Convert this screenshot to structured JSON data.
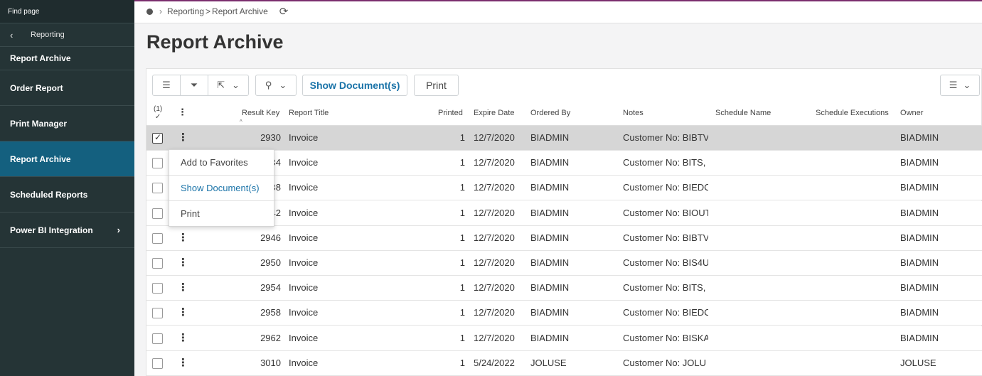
{
  "sidebar": {
    "find_page": "Find page",
    "back_label": "Reporting",
    "section_title": "Report Archive",
    "items": [
      {
        "label": "Order Report"
      },
      {
        "label": "Print Manager"
      },
      {
        "label": "Report Archive",
        "active": true
      },
      {
        "label": "Scheduled Reports"
      },
      {
        "label": "Power BI Integration",
        "has_children": true
      }
    ]
  },
  "breadcrumb": {
    "part1": "Reporting",
    "separator": ">",
    "part2": "Report Archive"
  },
  "page": {
    "title": "Report Archive"
  },
  "toolbar": {
    "show_documents": "Show Document(s)",
    "print": "Print"
  },
  "table": {
    "selected_count": "(1)",
    "columns": [
      "Result Key",
      "Report Title",
      "Printed",
      "Expire Date",
      "Ordered By",
      "Notes",
      "Schedule Name",
      "Schedule Executions",
      "Owner"
    ],
    "rows": [
      {
        "key": "2930",
        "title": "Invoice",
        "printed": "1",
        "expire": "12/7/2020",
        "ordered_by": "BIADMIN",
        "notes": "Customer No: BIBTV",
        "owner": "BIADMIN",
        "checked": true
      },
      {
        "key": "2934",
        "title": "Invoice",
        "printed": "1",
        "expire": "12/7/2020",
        "ordered_by": "BIADMIN",
        "notes": "Customer No: BITS,",
        "owner": "BIADMIN"
      },
      {
        "key": "2938",
        "title": "Invoice",
        "printed": "1",
        "expire": "12/7/2020",
        "ordered_by": "BIADMIN",
        "notes": "Customer No: BIEDC",
        "owner": "BIADMIN"
      },
      {
        "key": "2942",
        "title": "Invoice",
        "printed": "1",
        "expire": "12/7/2020",
        "ordered_by": "BIADMIN",
        "notes": "Customer No: BIOUT",
        "owner": "BIADMIN"
      },
      {
        "key": "2946",
        "title": "Invoice",
        "printed": "1",
        "expire": "12/7/2020",
        "ordered_by": "BIADMIN",
        "notes": "Customer No: BIBTV",
        "owner": "BIADMIN"
      },
      {
        "key": "2950",
        "title": "Invoice",
        "printed": "1",
        "expire": "12/7/2020",
        "ordered_by": "BIADMIN",
        "notes": "Customer No: BIS4U",
        "owner": "BIADMIN"
      },
      {
        "key": "2954",
        "title": "Invoice",
        "printed": "1",
        "expire": "12/7/2020",
        "ordered_by": "BIADMIN",
        "notes": "Customer No: BITS,",
        "owner": "BIADMIN"
      },
      {
        "key": "2958",
        "title": "Invoice",
        "printed": "1",
        "expire": "12/7/2020",
        "ordered_by": "BIADMIN",
        "notes": "Customer No: BIEDC",
        "owner": "BIADMIN"
      },
      {
        "key": "2962",
        "title": "Invoice",
        "printed": "1",
        "expire": "12/7/2020",
        "ordered_by": "BIADMIN",
        "notes": "Customer No: BISKA",
        "owner": "BIADMIN"
      },
      {
        "key": "3010",
        "title": "Invoice",
        "printed": "1",
        "expire": "5/24/2022",
        "ordered_by": "JOLUSE",
        "notes": "Customer No: JOLU",
        "owner": "JOLUSE"
      }
    ]
  },
  "context_menu": {
    "items": [
      "Add to Favorites",
      "Show Document(s)",
      "Print"
    ]
  },
  "colors": {
    "sidebar_bg": "#253436",
    "sidebar_active": "#14607f",
    "accent_link": "#1a73a8"
  },
  "icons": [
    "chevron-left-icon",
    "chevron-right-icon",
    "home-dot-icon",
    "refresh-icon",
    "list-icon",
    "filter-icon",
    "export-icon",
    "chevron-down-icon",
    "stamp-icon",
    "table-view-icon",
    "kebab-icon",
    "checkbox-icon"
  ]
}
